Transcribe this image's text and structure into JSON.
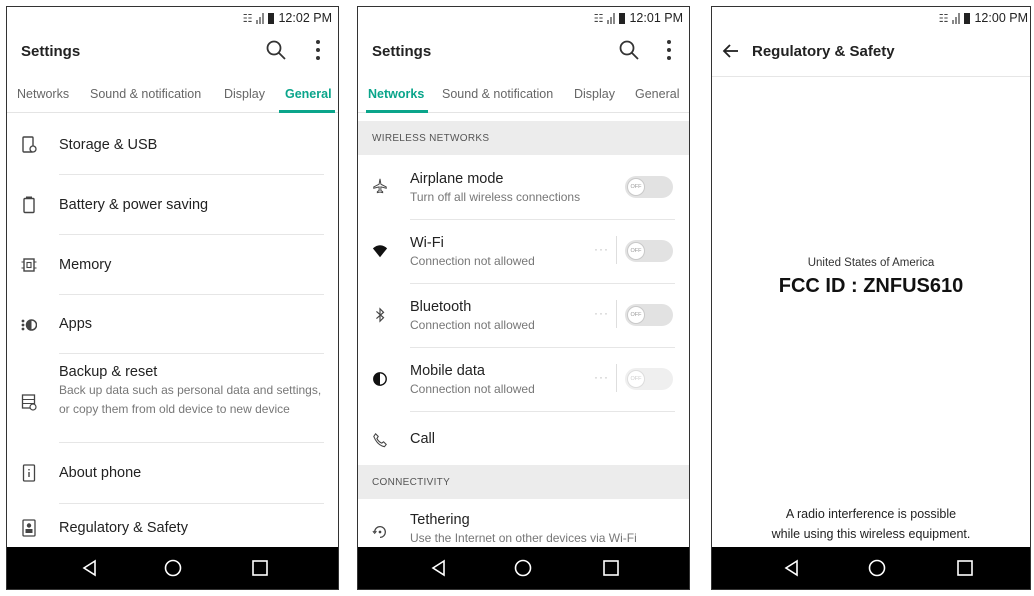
{
  "status": {
    "phone1_time": "12:02 PM",
    "phone2_time": "12:01 PM",
    "phone3_time": "12:00 PM"
  },
  "phone1": {
    "title": "Settings",
    "tabs": [
      "Networks",
      "Sound & notification",
      "Display",
      "General"
    ],
    "active_tab": "General",
    "items": [
      {
        "label": "Storage & USB",
        "icon": "storage-icon"
      },
      {
        "label": "Battery & power saving",
        "icon": "battery-icon"
      },
      {
        "label": "Memory",
        "icon": "memory-chip-icon"
      },
      {
        "label": "Apps",
        "icon": "apps-icon"
      },
      {
        "label": "Backup & reset",
        "sub": "Back up data such as personal data and settings, or copy them from old device to new device",
        "icon": "backup-icon"
      },
      {
        "label": "About phone",
        "icon": "info-icon"
      },
      {
        "label": "Regulatory & Safety",
        "icon": "regulatory-icon"
      }
    ]
  },
  "phone2": {
    "title": "Settings",
    "tabs": [
      "Networks",
      "Sound & notification",
      "Display",
      "General"
    ],
    "active_tab": "Networks",
    "section_wireless": "WIRELESS NETWORKS",
    "items": [
      {
        "label": "Airplane mode",
        "sub": "Turn off all wireless connections",
        "toggle": "OFF",
        "icon": "airplane-icon"
      },
      {
        "label": "Wi-Fi",
        "sub": "Connection not allowed",
        "toggle": "OFF",
        "icon": "wifi-icon"
      },
      {
        "label": "Bluetooth",
        "sub": "Connection not allowed",
        "toggle": "OFF",
        "icon": "bluetooth-icon"
      },
      {
        "label": "Mobile data",
        "sub": "Connection not allowed",
        "toggle": "OFF",
        "icon": "mobile-data-icon"
      },
      {
        "label": "Call",
        "icon": "call-icon"
      }
    ],
    "section_connectivity": "CONNECTIVITY",
    "tethering": {
      "label": "Tethering",
      "sub": "Use the Internet on other devices via Wi-Fi",
      "icon": "tethering-icon"
    }
  },
  "phone3": {
    "title": "Regulatory & Safety",
    "country": "United States of America",
    "fcc_id": "FCC ID : ZNFUS610",
    "warning_line1": "A radio interference is possible",
    "warning_line2": "while using this wireless equipment."
  },
  "colors": {
    "accent": "#0aa58b",
    "section_bg": "#ececec",
    "nav_bg": "#000000"
  }
}
